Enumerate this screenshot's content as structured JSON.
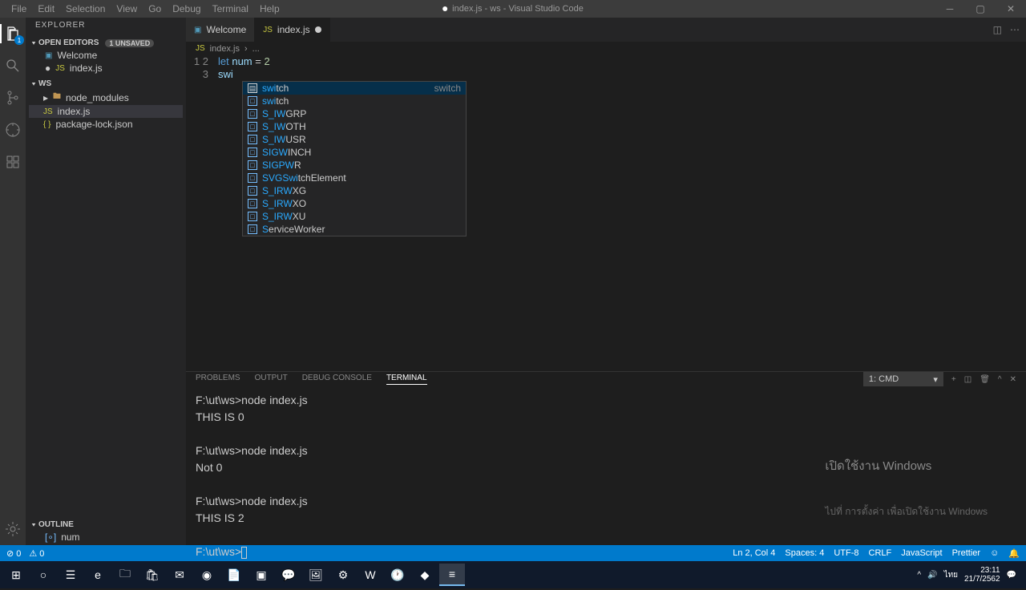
{
  "title": "index.js - ws - Visual Studio Code",
  "menu": [
    "File",
    "Edit",
    "Selection",
    "View",
    "Go",
    "Debug",
    "Terminal",
    "Help"
  ],
  "window_controls": [
    "min",
    "max",
    "close"
  ],
  "activitybar": {
    "items": [
      {
        "name": "explorer",
        "badge": "1"
      },
      {
        "name": "search"
      },
      {
        "name": "git"
      },
      {
        "name": "debug"
      },
      {
        "name": "extensions"
      }
    ],
    "bottom": "settings"
  },
  "sidebar": {
    "header": "EXPLORER",
    "open_editors": {
      "title": "OPEN EDITORS",
      "badge": "1 UNSAVED",
      "items": [
        {
          "label": "Welcome",
          "icon": "vs"
        },
        {
          "label": "index.js",
          "icon": "js",
          "dirty": true
        }
      ]
    },
    "workspace": {
      "title": "WS",
      "items": [
        {
          "label": "node_modules",
          "type": "folder",
          "depth": 1
        },
        {
          "label": "index.js",
          "type": "js",
          "depth": 1,
          "selected": true
        },
        {
          "label": "package-lock.json",
          "type": "json",
          "depth": 1
        }
      ]
    },
    "outline": {
      "title": "OUTLINE",
      "items": [
        {
          "label": "num",
          "icon": "var"
        }
      ]
    }
  },
  "tabs": [
    {
      "label": "Welcome",
      "icon": "vs"
    },
    {
      "label": "index.js",
      "icon": "js",
      "active": true,
      "dirty": true
    }
  ],
  "breadcrumb": [
    "index.js",
    "..."
  ],
  "code": {
    "lines": [
      {
        "n": 1,
        "tokens": [
          {
            "t": "let ",
            "c": "kw"
          },
          {
            "t": "num",
            "c": "var"
          },
          {
            "t": " = ",
            "c": "op"
          },
          {
            "t": "2",
            "c": "num"
          }
        ]
      },
      {
        "n": 2,
        "tokens": [
          {
            "t": "swi",
            "c": "var"
          }
        ]
      },
      {
        "n": 3,
        "tokens": []
      }
    ]
  },
  "suggest": {
    "detail": "switch",
    "items": [
      {
        "label": "switch",
        "hl": "swi",
        "kind": "snip",
        "selected": true
      },
      {
        "label": "switch",
        "hl": "swi",
        "kind": "kw"
      },
      {
        "label": "S_IWGRP",
        "hl": "S_IW",
        "kind": "var"
      },
      {
        "label": "S_IWOTH",
        "hl": "S_IW",
        "kind": "var"
      },
      {
        "label": "S_IWUSR",
        "hl": "S_IW",
        "kind": "var"
      },
      {
        "label": "SIGWINCH",
        "hl": "SIGW",
        "kind": "var"
      },
      {
        "label": "SIGPWR",
        "hl": "SIGPW",
        "kind": "var"
      },
      {
        "label": "SVGSwitchElement",
        "hl": "SVGSwi",
        "kind": "var"
      },
      {
        "label": "S_IRWXG",
        "hl": "S_IRW",
        "kind": "var"
      },
      {
        "label": "S_IRWXO",
        "hl": "S_IRW",
        "kind": "var"
      },
      {
        "label": "S_IRWXU",
        "hl": "S_IRW",
        "kind": "var"
      },
      {
        "label": "ServiceWorker",
        "hl": "S",
        "kind": "var"
      }
    ]
  },
  "panel": {
    "tabs": [
      "PROBLEMS",
      "OUTPUT",
      "DEBUG CONSOLE",
      "TERMINAL"
    ],
    "active": "TERMINAL",
    "selector": "1: cmd",
    "terminal_text": "F:\\ut\\ws>node index.js\nTHIS IS 0\n\nF:\\ut\\ws>node index.js\nNot 0\n\nF:\\ut\\ws>node index.js\nTHIS IS 2\n\nF:\\ut\\ws>"
  },
  "statusbar": {
    "left": [
      "⊘ 0",
      "⚠ 0"
    ],
    "right": [
      "Ln 2, Col 4",
      "Spaces: 4",
      "UTF-8",
      "CRLF",
      "JavaScript",
      "Prettier",
      "☺",
      "🔔"
    ]
  },
  "watermark": {
    "big": "เปิดใช้งาน Windows",
    "small": "ไปที่ การตั้งค่า เพื่อเปิดใช้งาน Windows"
  },
  "taskbar": {
    "icons": [
      "start",
      "search",
      "taskview",
      "edge",
      "folder",
      "store",
      "mail",
      "chrome",
      "notepad",
      "cmd",
      "line",
      "photos",
      "settings",
      "word",
      "clock",
      "gamebar",
      "vscode"
    ],
    "active": "vscode",
    "tray": {
      "time": "23:11",
      "date": "21/7/2562"
    }
  }
}
